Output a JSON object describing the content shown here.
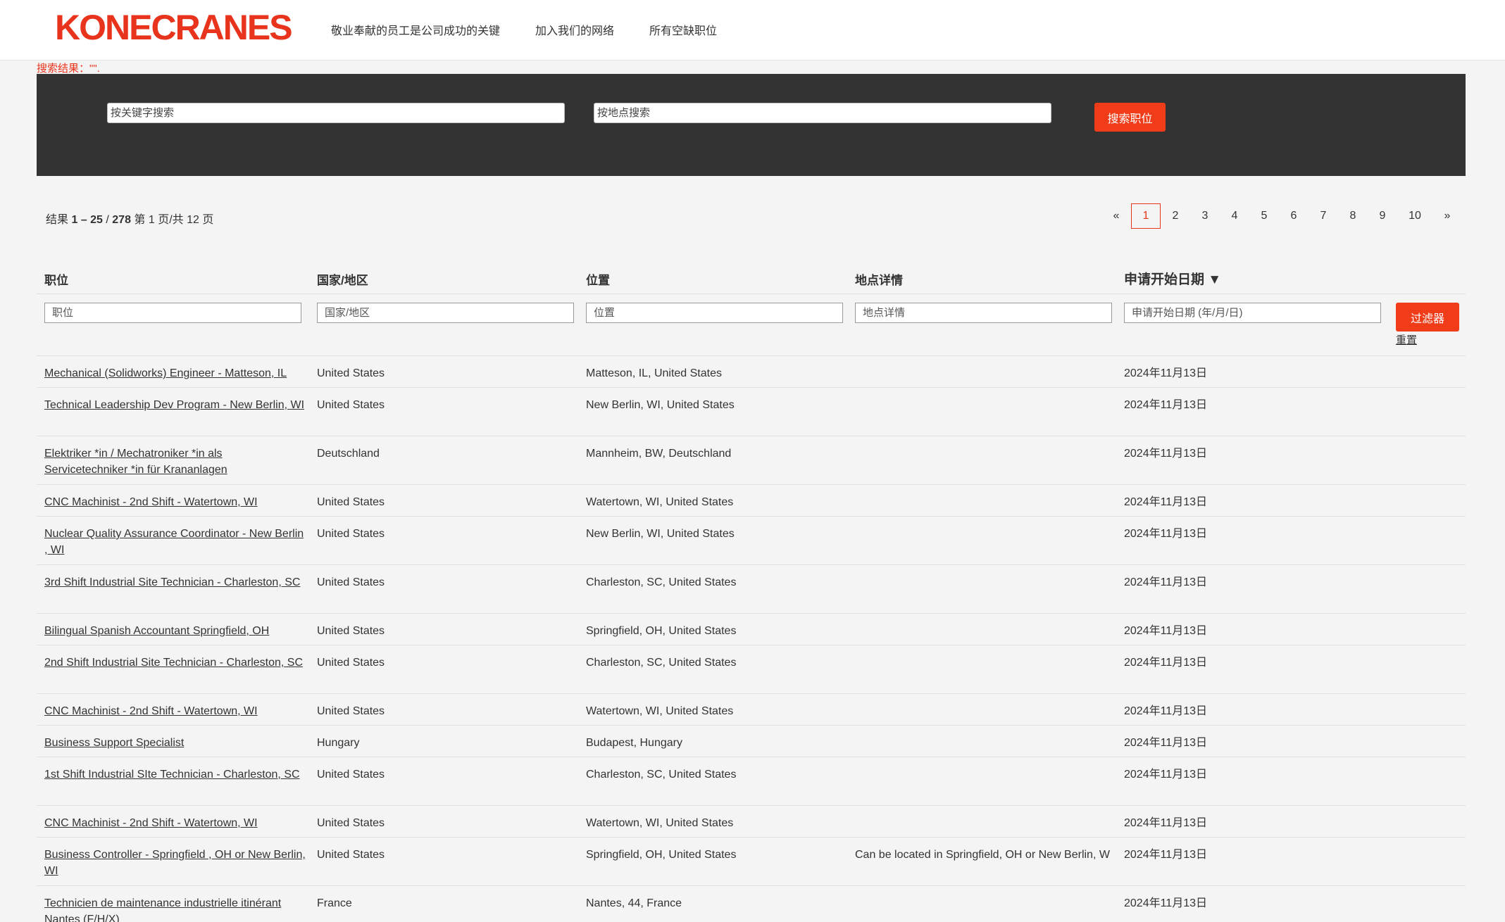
{
  "header": {
    "logo": "KONECRANES",
    "nav": [
      "敬业奉献的员工是公司成功的关键",
      "加入我们的网络",
      "所有空缺职位"
    ]
  },
  "search_note": "搜索结果：\"\".",
  "search": {
    "keyword_placeholder": "按关键字搜索",
    "location_placeholder": "按地点搜索",
    "button": "搜索职位"
  },
  "summary": {
    "prefix": "结果 ",
    "range": "1 – 25",
    "sep": " / ",
    "total": "278",
    "page_info": " 第 1 页/共 12 页"
  },
  "pagination": {
    "prev": "«",
    "pages": [
      "1",
      "2",
      "3",
      "4",
      "5",
      "6",
      "7",
      "8",
      "9",
      "10"
    ],
    "current": "1",
    "next": "»"
  },
  "table": {
    "headers": [
      "职位",
      "国家/地区",
      "位置",
      "地点详情",
      "申请开始日期 ▼"
    ],
    "filters": [
      "职位",
      "国家/地区",
      "位置",
      "地点详情",
      "申请开始日期 (年/月/日)"
    ],
    "filter_button": "过滤器",
    "reset": "重置",
    "rows": [
      [
        "Mechanical (Solidworks) Engineer - Matteson, IL",
        "United States",
        "Matteson, IL, United States",
        "",
        "2024年11月13日"
      ],
      [
        "Technical Leadership Dev Program - New Berlin, WI",
        "United States",
        "New Berlin, WI, United States",
        "",
        "2024年11月13日"
      ],
      [
        "Elektriker *in / Mechatroniker *in als Servicetechniker *in für Krananlagen",
        "Deutschland",
        "Mannheim, BW, Deutschland",
        "",
        "2024年11月13日"
      ],
      [
        "CNC Machinist - 2nd Shift - Watertown, WI",
        "United States",
        "Watertown, WI, United States",
        "",
        "2024年11月13日"
      ],
      [
        "Nuclear Quality Assurance Coordinator - New Berlin , WI",
        "United States",
        "New Berlin, WI, United States",
        "",
        "2024年11月13日"
      ],
      [
        "3rd Shift Industrial Site Technician - Charleston, SC",
        "United States",
        "Charleston, SC, United States",
        "",
        "2024年11月13日"
      ],
      [
        "Bilingual Spanish Accountant Springfield, OH",
        "United States",
        "Springfield, OH, United States",
        "",
        "2024年11月13日"
      ],
      [
        "2nd Shift Industrial Site Technician - Charleston, SC",
        "United States",
        "Charleston, SC, United States",
        "",
        "2024年11月13日"
      ],
      [
        "CNC Machinist - 2nd Shift - Watertown, WI",
        "United States",
        "Watertown, WI, United States",
        "",
        "2024年11月13日"
      ],
      [
        "Business Support Specialist",
        "Hungary",
        "Budapest, Hungary",
        "",
        "2024年11月13日"
      ],
      [
        "1st Shift Industrial SIte Technician - Charleston, SC",
        "United States",
        "Charleston, SC, United States",
        "",
        "2024年11月13日"
      ],
      [
        "CNC Machinist - 2nd Shift - Watertown, WI",
        "United States",
        "Watertown, WI, United States",
        "",
        "2024年11月13日"
      ],
      [
        "Business Controller - Springfield , OH or New Berlin, WI",
        "United States",
        "Springfield, OH, United States",
        "Can be located in Springfield, OH or New Berlin, W",
        "2024年11月13日"
      ],
      [
        "Technicien de maintenance industrielle itinérant Nantes (F/H/X)",
        "France",
        "Nantes, 44, France",
        "",
        "2024年11月13日"
      ]
    ]
  },
  "colors": {
    "brand": "#e8341c",
    "band": "#333333",
    "page_bg": "#f4f4f4"
  }
}
